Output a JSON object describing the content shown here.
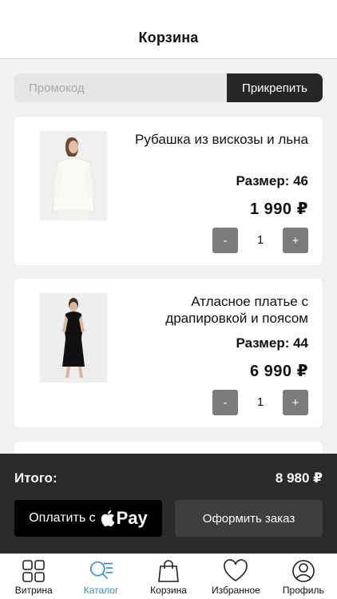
{
  "header": {
    "title": "Корзина"
  },
  "promo": {
    "placeholder": "Промокод",
    "button_label": "Прикрепить"
  },
  "cart_items": [
    {
      "name": "Рубашка из вискозы и льна",
      "size": "Размер: 46",
      "price": "1 990 ₽",
      "quantity": "1",
      "decrement": "-",
      "increment": "+"
    },
    {
      "name": "Атласное платье с драпировкой и поясом",
      "size": "Размер: 44",
      "price": "6 990 ₽",
      "quantity": "1",
      "decrement": "-",
      "increment": "+"
    }
  ],
  "summary": {
    "total_label": "Итого:",
    "total_value": "8 980 ₽",
    "pay_label": "Оплатить с",
    "pay_brand": "Pay",
    "checkout_label": "Оформить заказ"
  },
  "tabbar": {
    "items": [
      {
        "label": "Витрина",
        "icon": "grid-icon",
        "active": false
      },
      {
        "label": "Каталог",
        "icon": "search-list-icon",
        "active": true
      },
      {
        "label": "Корзина",
        "icon": "bag-icon",
        "active": false
      },
      {
        "label": "Избранное",
        "icon": "heart-icon",
        "active": false
      },
      {
        "label": "Профиль",
        "icon": "profile-icon",
        "active": false
      }
    ]
  },
  "colors": {
    "accent": "#3a8fd6",
    "dark": "#2a2a2a",
    "stepper": "#7b7b7e"
  }
}
